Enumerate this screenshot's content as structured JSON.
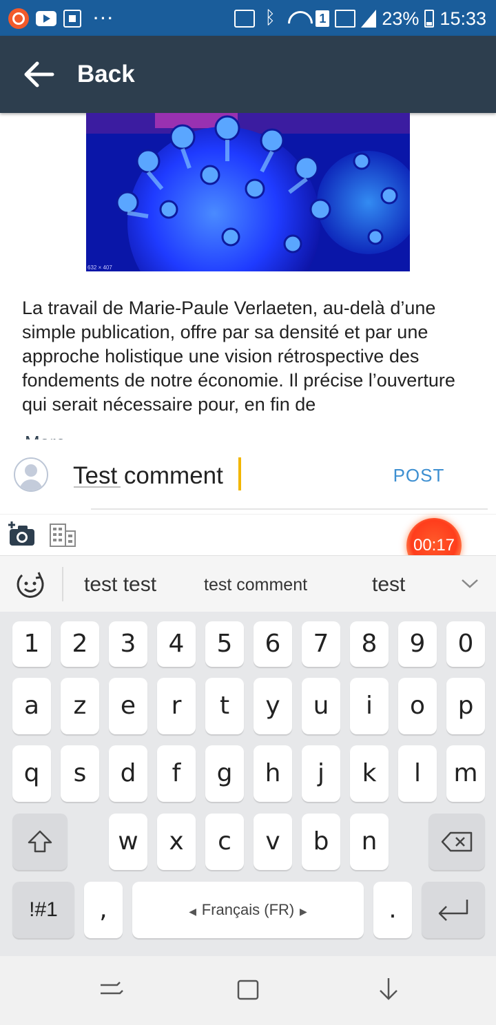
{
  "status_bar": {
    "icons": [
      "app-circle-icon",
      "youtube-icon",
      "tv-app-icon",
      "more-dots-icon",
      "cast-icon",
      "bluetooth-icon",
      "wifi-icon",
      "sim-icon",
      "signal-icon",
      "signal-icon",
      "battery-icon"
    ],
    "dots": "···",
    "sim": "1",
    "battery": "23%",
    "time": "15:33"
  },
  "app_bar": {
    "back_label": "Back"
  },
  "article": {
    "text": "La travail de Marie-Paule Verlaeten, au-delà d’une simple publication, offre par sa densité et par une approche holistique une vision rétrospective des fondements de notre économie.  Il précise l’ouverture qui serait nécessaire pour, en fin de",
    "more_label": "More",
    "image_caption": "632 × 407"
  },
  "composer": {
    "input_value": "Test comment",
    "post_label": "POST",
    "timer": "00:17"
  },
  "keyboard": {
    "suggestions": [
      "test test",
      "test comment",
      "test"
    ],
    "row_numbers": [
      "1",
      "2",
      "3",
      "4",
      "5",
      "6",
      "7",
      "8",
      "9",
      "0"
    ],
    "row_1": [
      "a",
      "z",
      "e",
      "r",
      "t",
      "y",
      "u",
      "i",
      "o",
      "p"
    ],
    "row_2": [
      "q",
      "s",
      "d",
      "f",
      "g",
      "h",
      "j",
      "k",
      "l",
      "m"
    ],
    "row_3": [
      "w",
      "x",
      "c",
      "v",
      "b",
      "n"
    ],
    "symbols_label": "!#1",
    "comma": ",",
    "period": ".",
    "language_label": "Français (FR)"
  },
  "colors": {
    "status_bar": "#1a5d9b",
    "app_bar": "#2d3e4e",
    "post": "#3d8fd1",
    "cursor": "#f2b600",
    "timer": "#ff3d1c"
  }
}
